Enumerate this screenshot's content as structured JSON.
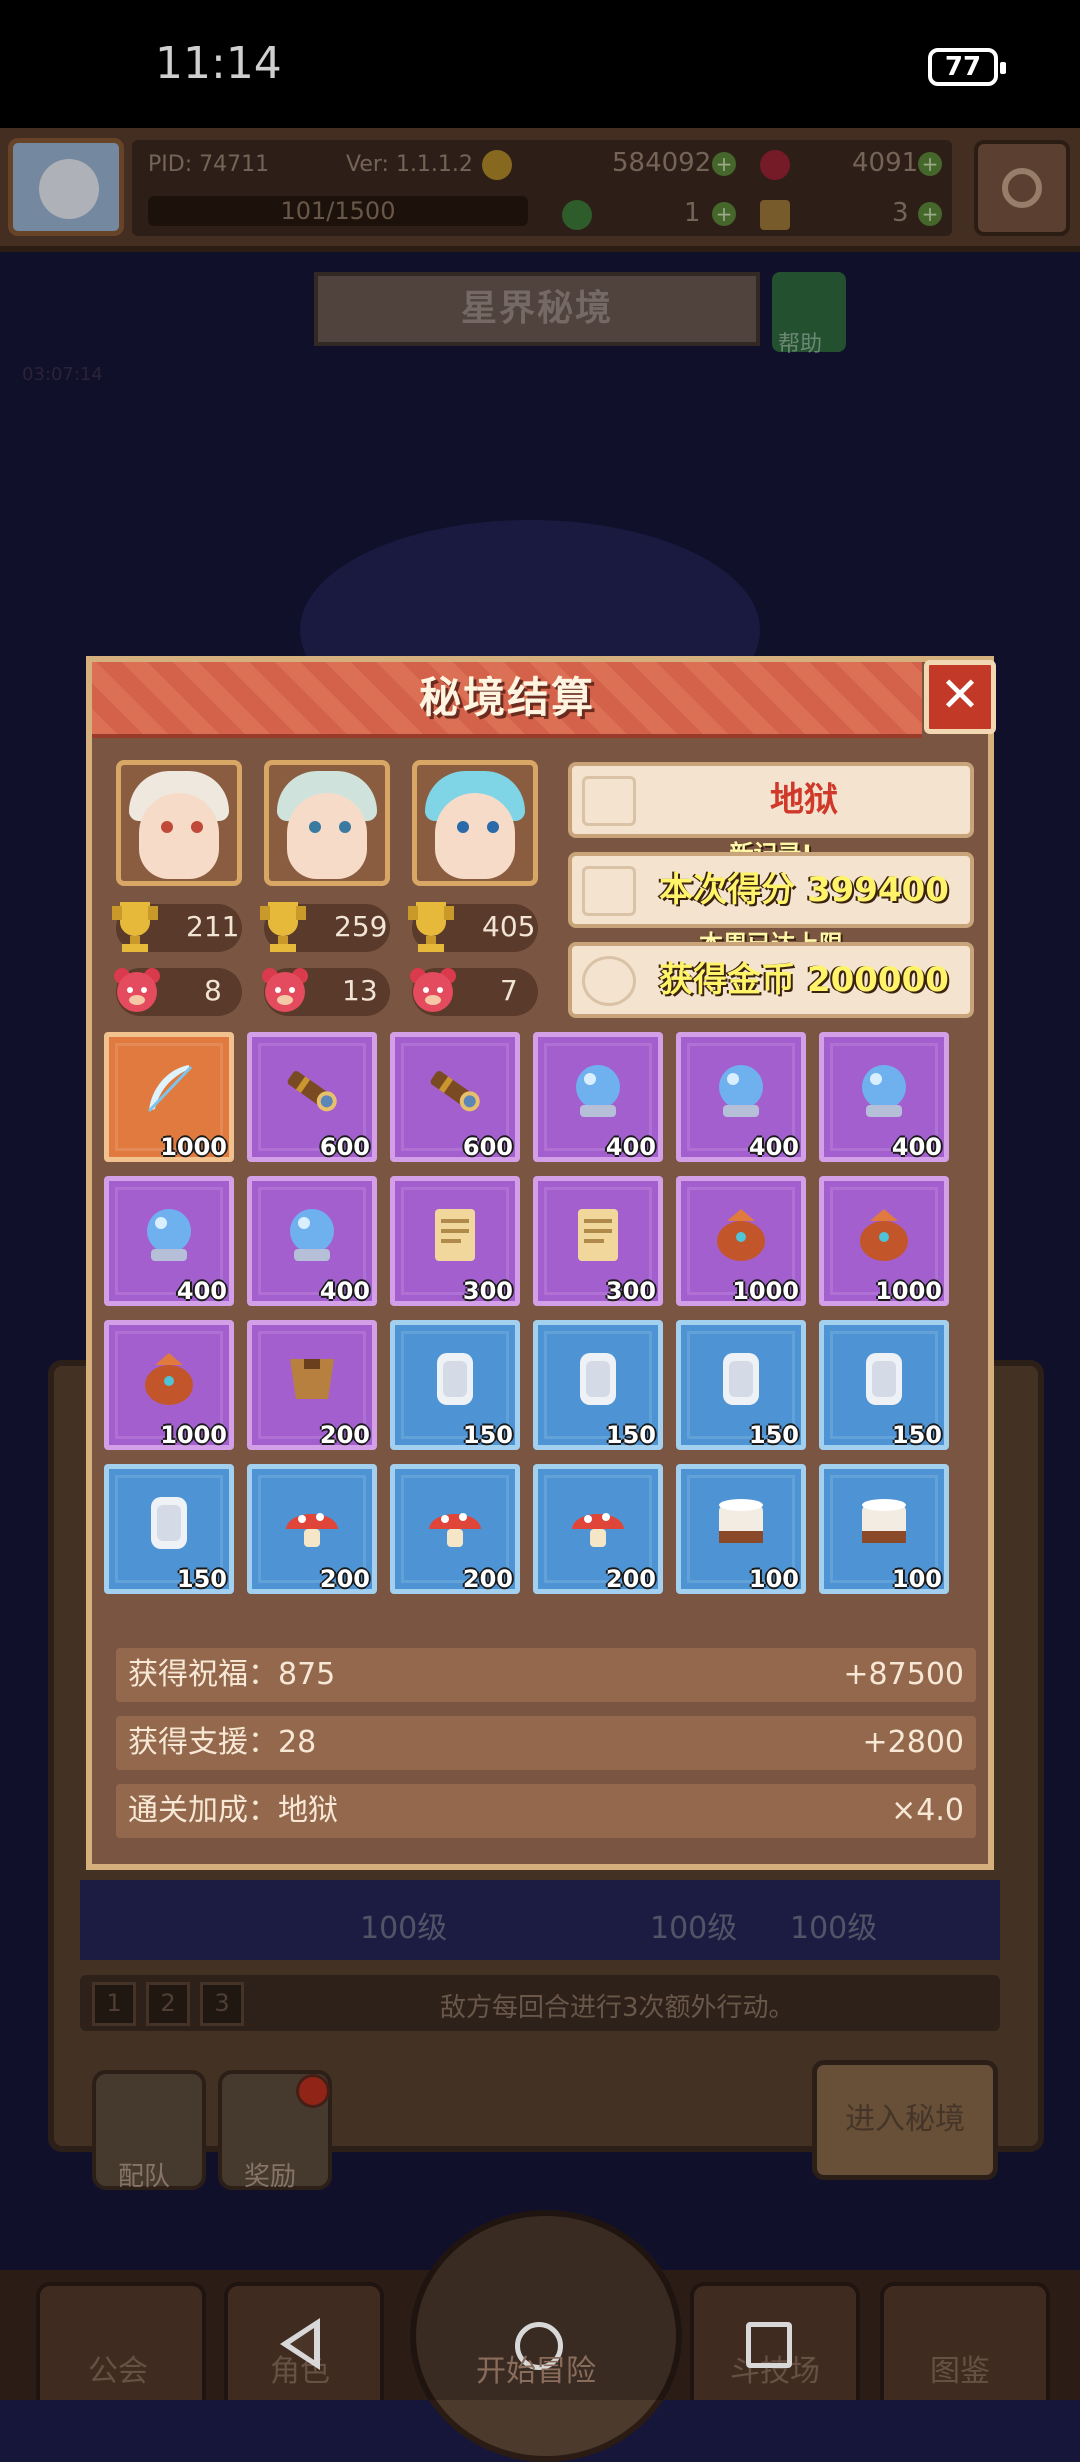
{
  "status_bar": {
    "time": "11:14",
    "battery": "77"
  },
  "hud": {
    "pid": "PID: 74711",
    "version": "Ver: 1.1.1.2",
    "gold": "584092",
    "gems": "4091",
    "exp": "101/1500",
    "clover": "1",
    "key": "3"
  },
  "realm": {
    "title": "星界秘境",
    "help": "帮助",
    "timer": "03:07:14"
  },
  "modal": {
    "title": "秘境结算",
    "close": "✕",
    "difficulty": "地狱",
    "new_record": "新记录!",
    "score": "本次得分 399400",
    "weekly_cap": "本周已达上限",
    "coins": "获得金币 200000",
    "heroes": [
      {
        "trophy": "211",
        "bear": "8"
      },
      {
        "trophy": "259",
        "bear": "13"
      },
      {
        "trophy": "405",
        "bear": "7"
      }
    ],
    "items": [
      {
        "type": "feather",
        "rarity": "orange",
        "qty": "1000"
      },
      {
        "type": "telescope",
        "rarity": "purple",
        "qty": "600"
      },
      {
        "type": "telescope",
        "rarity": "purple",
        "qty": "600"
      },
      {
        "type": "crystal-ball",
        "rarity": "purple",
        "qty": "400"
      },
      {
        "type": "crystal-ball",
        "rarity": "purple",
        "qty": "400"
      },
      {
        "type": "crystal-ball",
        "rarity": "purple",
        "qty": "400"
      },
      {
        "type": "crystal-ball",
        "rarity": "purple",
        "qty": "400"
      },
      {
        "type": "crystal-ball",
        "rarity": "purple",
        "qty": "400"
      },
      {
        "type": "scroll",
        "rarity": "purple",
        "qty": "300"
      },
      {
        "type": "scroll",
        "rarity": "purple",
        "qty": "300"
      },
      {
        "type": "pouch",
        "rarity": "purple",
        "qty": "1000"
      },
      {
        "type": "pouch",
        "rarity": "purple",
        "qty": "1000"
      },
      {
        "type": "pouch",
        "rarity": "purple",
        "qty": "1000"
      },
      {
        "type": "armor",
        "rarity": "purple",
        "qty": "200"
      },
      {
        "type": "tablet",
        "rarity": "blue",
        "qty": "150"
      },
      {
        "type": "tablet",
        "rarity": "blue",
        "qty": "150"
      },
      {
        "type": "tablet",
        "rarity": "blue",
        "qty": "150"
      },
      {
        "type": "tablet",
        "rarity": "blue",
        "qty": "150"
      },
      {
        "type": "tablet",
        "rarity": "blue",
        "qty": "150"
      },
      {
        "type": "mushroom",
        "rarity": "blue",
        "qty": "200"
      },
      {
        "type": "mushroom",
        "rarity": "blue",
        "qty": "200"
      },
      {
        "type": "mushroom",
        "rarity": "blue",
        "qty": "200"
      },
      {
        "type": "drum",
        "rarity": "blue",
        "qty": "100"
      },
      {
        "type": "drum",
        "rarity": "blue",
        "qty": "100"
      }
    ],
    "summary": [
      {
        "label": "获得祝福：875",
        "value": "+87500"
      },
      {
        "label": "获得支援：28",
        "value": "+2800"
      },
      {
        "label": "通关加成：地狱",
        "value": "×4.0"
      }
    ]
  },
  "under": {
    "levels": [
      "100级",
      "100级",
      "100级"
    ],
    "pages": [
      "1",
      "2",
      "3"
    ],
    "info": "敌方每回合进行3次额外行动。",
    "btn_team": "配队",
    "btn_reward": "奖励",
    "btn_enter": "进入秘境"
  },
  "nav": {
    "guild": "公会",
    "character": "角色",
    "adventure": "开始冒险",
    "arena": "斗技场",
    "codex": "图鉴"
  },
  "colors": {
    "modal_header": "#d4614a",
    "purple_item": "#a45fcf",
    "blue_item": "#4e94d4",
    "orange_item": "#e07a3f",
    "difficulty_text": "#d0382a"
  }
}
